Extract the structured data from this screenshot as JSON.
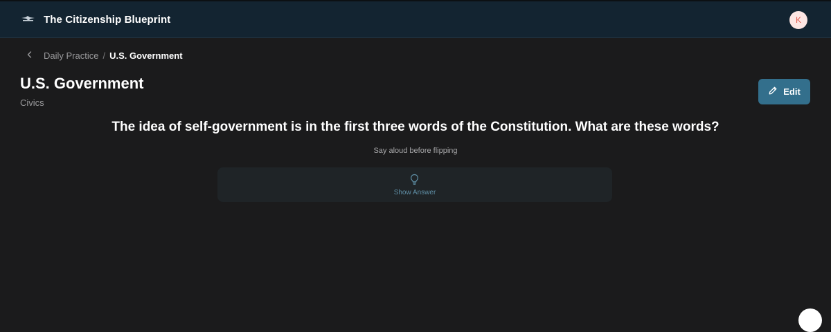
{
  "app": {
    "title": "The Citizenship Blueprint",
    "logo_icon": "eagle-logo-icon",
    "avatar_initial": "K"
  },
  "breadcrumb": {
    "back_icon": "chevron-left-icon",
    "parent": "Daily Practice",
    "separator": "/",
    "current": "U.S. Government"
  },
  "page": {
    "title": "U.S. Government",
    "subtitle": "Civics",
    "edit_label": "Edit",
    "edit_icon": "pencil-icon"
  },
  "card": {
    "question": "The idea of self-government is in the first three words of the Constitution. What are these words?",
    "hint": "Say aloud before flipping",
    "reveal_label": "Show Answer",
    "reveal_icon": "lightbulb-icon"
  },
  "colors": {
    "header_bg": "#132431",
    "page_bg": "#1b1b1c",
    "accent": "#336f8c",
    "avatar_bg": "#fde6e3",
    "avatar_text": "#e25d52"
  }
}
